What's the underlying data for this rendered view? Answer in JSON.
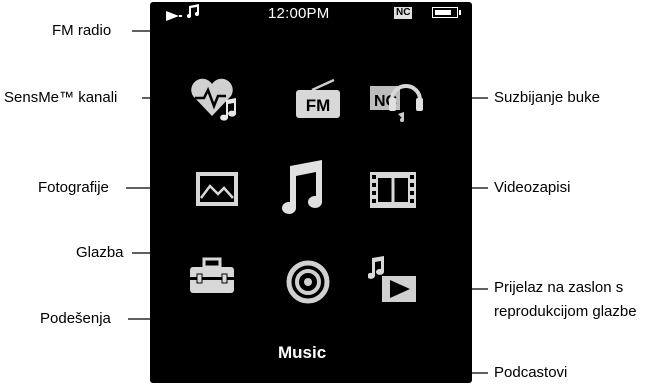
{
  "status_bar": {
    "time": "12:00PM",
    "nc_badge": "NC",
    "battery_level": 0.8
  },
  "screen_title": "Music",
  "labels": {
    "fm_radio": "FM radio",
    "sensme": "SensMe™ kanali",
    "photos": "Fotografije",
    "music": "Glazba",
    "settings": "Podešenja",
    "noise_cancel": "Suzbijanje buke",
    "videos": "Videozapisi",
    "now_playing_line1": "Prijelaz na zaslon s",
    "now_playing_line2": "reprodukcijom glazbe",
    "podcasts": "Podcastovi"
  },
  "icons": {
    "fm_text": "FM",
    "sensme": "heart-note-icon",
    "fm": "radio-icon",
    "noise": "noise-cancel-icon",
    "photos": "photo-icon",
    "music": "music-note-icon",
    "videos": "film-icon",
    "settings": "toolbox-icon",
    "podcasts": "podcast-icon",
    "now_playing": "play-screen-icon"
  },
  "colors": {
    "screen": "#000000",
    "icon_gray": "#d8d8d8",
    "leader_line": "#000000"
  }
}
